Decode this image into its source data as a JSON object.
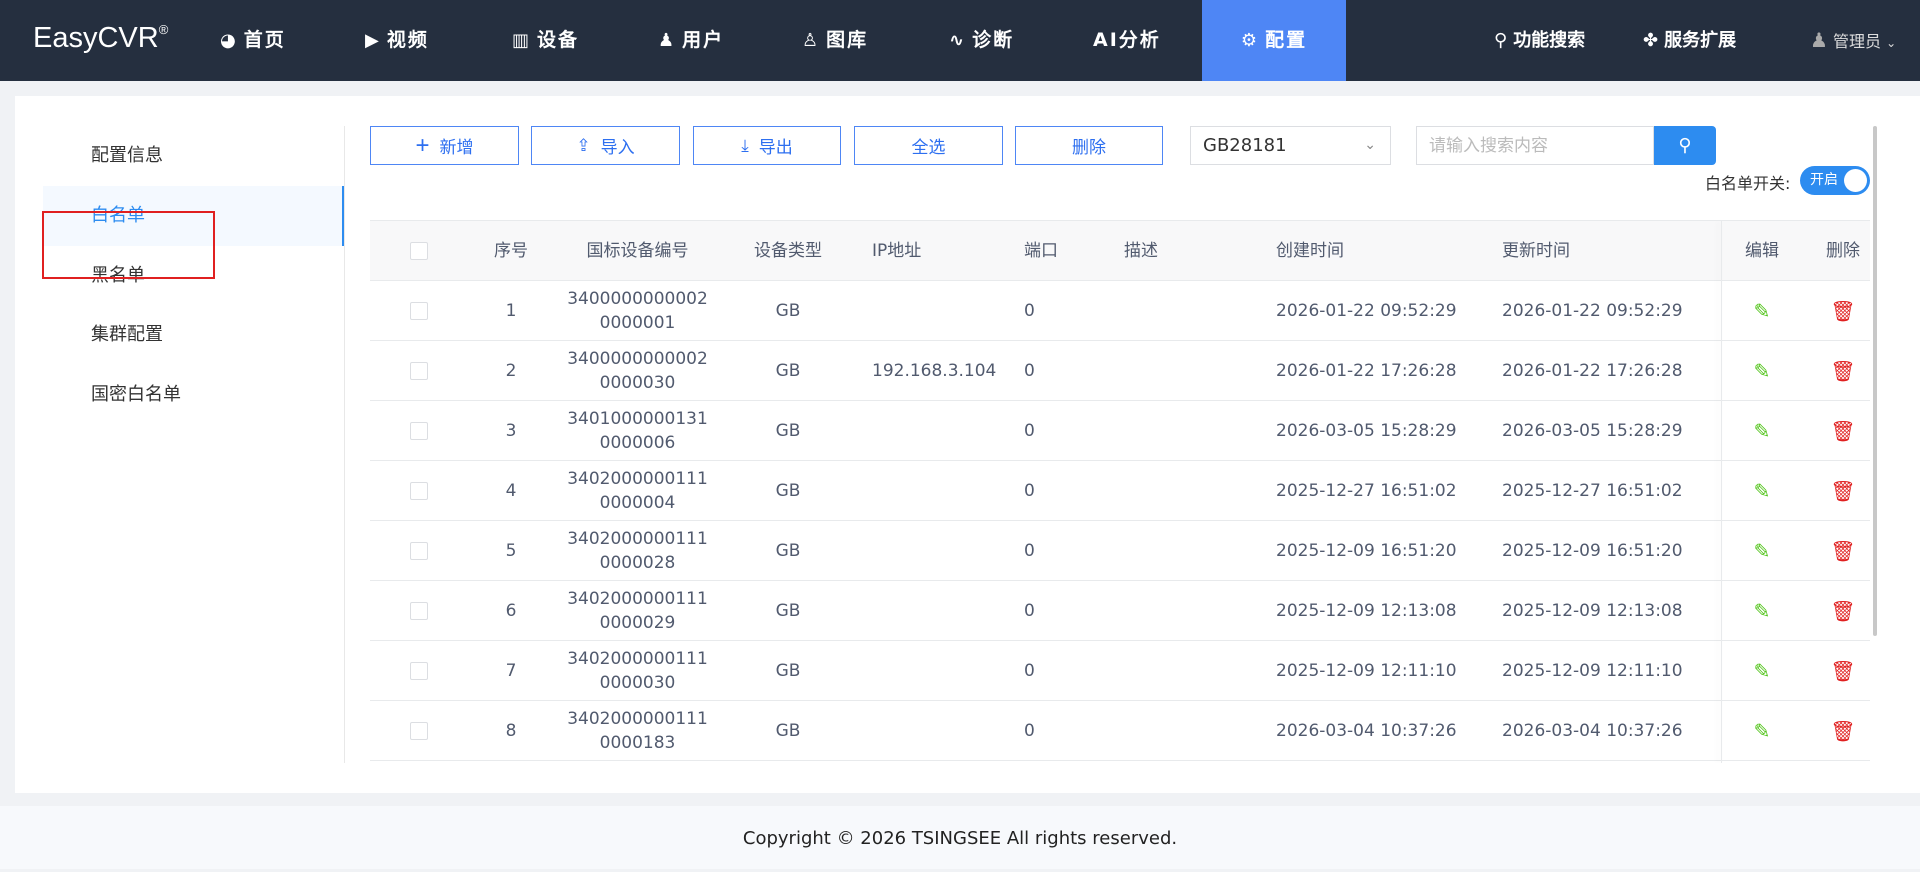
{
  "nav": {
    "logo": "EasyCVR",
    "logo_mark": "®",
    "items": [
      {
        "label": "首页",
        "icon": "dashboard-icon"
      },
      {
        "label": "视频",
        "icon": "play-icon"
      },
      {
        "label": "设备",
        "icon": "device-icon"
      },
      {
        "label": "用户",
        "icon": "user-icon"
      },
      {
        "label": "图库",
        "icon": "alarm-icon"
      },
      {
        "label": "诊断",
        "icon": "pulse-icon"
      },
      {
        "label": "AI分析",
        "icon": ""
      },
      {
        "label": "配置",
        "icon": "gear-icon",
        "active": true
      }
    ],
    "search": "功能搜索",
    "extend": "服务扩展",
    "user": "管理员",
    "accent": "#4e86f5"
  },
  "sidebar": {
    "items": [
      {
        "label": "配置信息"
      },
      {
        "label": "白名单",
        "selected": true
      },
      {
        "label": "黑名单"
      },
      {
        "label": "集群配置"
      },
      {
        "label": "国密白名单"
      }
    ]
  },
  "toolbar": {
    "add": "新增",
    "import": "导入",
    "export": "导出",
    "select_all": "全选",
    "delete": "删除",
    "type_select": "GB28181",
    "search_placeholder": "请输入搜索内容",
    "switch_label": "白名单开关:",
    "switch_state": "开启"
  },
  "table": {
    "headers": [
      "序号",
      "国标设备编号",
      "设备类型",
      "IP地址",
      "端口",
      "描述",
      "创建时间",
      "更新时间",
      "编辑",
      "删除"
    ],
    "rows": [
      {
        "no": "1",
        "id1": "3400000000002",
        "id2": "0000001",
        "type": "GB",
        "ip": "",
        "port": "0",
        "desc": "",
        "created": "2026-01-22 09:52:29",
        "updated": "2026-01-22 09:52:29"
      },
      {
        "no": "2",
        "id1": "3400000000002",
        "id2": "0000030",
        "type": "GB",
        "ip": "192.168.3.104",
        "port": "0",
        "desc": "",
        "created": "2026-01-22 17:26:28",
        "updated": "2026-01-22 17:26:28"
      },
      {
        "no": "3",
        "id1": "3401000000131",
        "id2": "0000006",
        "type": "GB",
        "ip": "",
        "port": "0",
        "desc": "",
        "created": "2026-03-05 15:28:29",
        "updated": "2026-03-05 15:28:29"
      },
      {
        "no": "4",
        "id1": "3402000000111",
        "id2": "0000004",
        "type": "GB",
        "ip": "",
        "port": "0",
        "desc": "",
        "created": "2025-12-27 16:51:02",
        "updated": "2025-12-27 16:51:02"
      },
      {
        "no": "5",
        "id1": "3402000000111",
        "id2": "0000028",
        "type": "GB",
        "ip": "",
        "port": "0",
        "desc": "",
        "created": "2025-12-09 16:51:20",
        "updated": "2025-12-09 16:51:20"
      },
      {
        "no": "6",
        "id1": "3402000000111",
        "id2": "0000029",
        "type": "GB",
        "ip": "",
        "port": "0",
        "desc": "",
        "created": "2025-12-09 12:13:08",
        "updated": "2025-12-09 12:13:08"
      },
      {
        "no": "7",
        "id1": "3402000000111",
        "id2": "0000030",
        "type": "GB",
        "ip": "",
        "port": "0",
        "desc": "",
        "created": "2025-12-09 12:11:10",
        "updated": "2025-12-09 12:11:10"
      },
      {
        "no": "8",
        "id1": "3402000000111",
        "id2": "0000183",
        "type": "GB",
        "ip": "",
        "port": "0",
        "desc": "",
        "created": "2026-03-04 10:37:26",
        "updated": "2026-03-04 10:37:26"
      }
    ]
  },
  "footer": "Copyright © 2026 TSINGSEE All rights reserved."
}
